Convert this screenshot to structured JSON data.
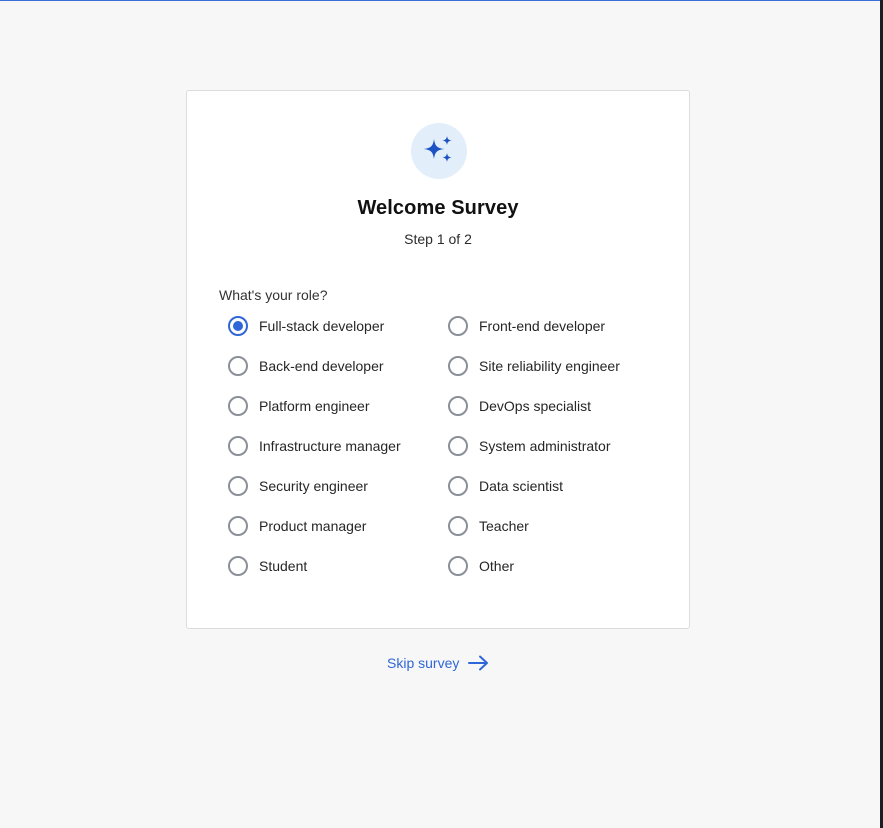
{
  "colors": {
    "accent": "#2f67d8",
    "icon_bg": "#e3eefb",
    "page_bg": "#f7f7f7"
  },
  "card": {
    "icon": "sparkles-icon",
    "title": "Welcome Survey",
    "step": "Step 1 of 2",
    "question": "What's your role?",
    "selected": "Full-stack developer",
    "options_left": [
      "Full-stack developer",
      "Back-end developer",
      "Platform engineer",
      "Infrastructure manager",
      "Security engineer",
      "Product manager",
      "Student"
    ],
    "options_right": [
      "Front-end developer",
      "Site reliability engineer",
      "DevOps specialist",
      "System administrator",
      "Data scientist",
      "Teacher",
      "Other"
    ]
  },
  "footer": {
    "skip_label": "Skip survey",
    "skip_icon": "arrow-right-icon"
  }
}
